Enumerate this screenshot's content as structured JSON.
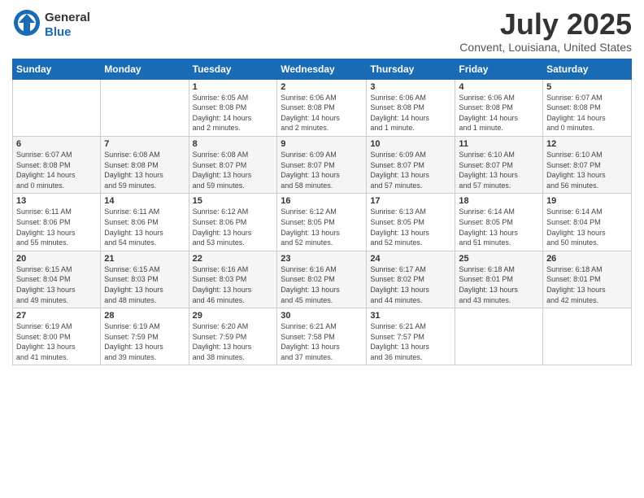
{
  "header": {
    "logo_general": "General",
    "logo_blue": "Blue",
    "title": "July 2025",
    "location": "Convent, Louisiana, United States"
  },
  "days_of_week": [
    "Sunday",
    "Monday",
    "Tuesday",
    "Wednesday",
    "Thursday",
    "Friday",
    "Saturday"
  ],
  "weeks": [
    [
      {
        "num": "",
        "info": ""
      },
      {
        "num": "",
        "info": ""
      },
      {
        "num": "1",
        "info": "Sunrise: 6:05 AM\nSunset: 8:08 PM\nDaylight: 14 hours\nand 2 minutes."
      },
      {
        "num": "2",
        "info": "Sunrise: 6:06 AM\nSunset: 8:08 PM\nDaylight: 14 hours\nand 2 minutes."
      },
      {
        "num": "3",
        "info": "Sunrise: 6:06 AM\nSunset: 8:08 PM\nDaylight: 14 hours\nand 1 minute."
      },
      {
        "num": "4",
        "info": "Sunrise: 6:06 AM\nSunset: 8:08 PM\nDaylight: 14 hours\nand 1 minute."
      },
      {
        "num": "5",
        "info": "Sunrise: 6:07 AM\nSunset: 8:08 PM\nDaylight: 14 hours\nand 0 minutes."
      }
    ],
    [
      {
        "num": "6",
        "info": "Sunrise: 6:07 AM\nSunset: 8:08 PM\nDaylight: 14 hours\nand 0 minutes."
      },
      {
        "num": "7",
        "info": "Sunrise: 6:08 AM\nSunset: 8:08 PM\nDaylight: 13 hours\nand 59 minutes."
      },
      {
        "num": "8",
        "info": "Sunrise: 6:08 AM\nSunset: 8:07 PM\nDaylight: 13 hours\nand 59 minutes."
      },
      {
        "num": "9",
        "info": "Sunrise: 6:09 AM\nSunset: 8:07 PM\nDaylight: 13 hours\nand 58 minutes."
      },
      {
        "num": "10",
        "info": "Sunrise: 6:09 AM\nSunset: 8:07 PM\nDaylight: 13 hours\nand 57 minutes."
      },
      {
        "num": "11",
        "info": "Sunrise: 6:10 AM\nSunset: 8:07 PM\nDaylight: 13 hours\nand 57 minutes."
      },
      {
        "num": "12",
        "info": "Sunrise: 6:10 AM\nSunset: 8:07 PM\nDaylight: 13 hours\nand 56 minutes."
      }
    ],
    [
      {
        "num": "13",
        "info": "Sunrise: 6:11 AM\nSunset: 8:06 PM\nDaylight: 13 hours\nand 55 minutes."
      },
      {
        "num": "14",
        "info": "Sunrise: 6:11 AM\nSunset: 8:06 PM\nDaylight: 13 hours\nand 54 minutes."
      },
      {
        "num": "15",
        "info": "Sunrise: 6:12 AM\nSunset: 8:06 PM\nDaylight: 13 hours\nand 53 minutes."
      },
      {
        "num": "16",
        "info": "Sunrise: 6:12 AM\nSunset: 8:05 PM\nDaylight: 13 hours\nand 52 minutes."
      },
      {
        "num": "17",
        "info": "Sunrise: 6:13 AM\nSunset: 8:05 PM\nDaylight: 13 hours\nand 52 minutes."
      },
      {
        "num": "18",
        "info": "Sunrise: 6:14 AM\nSunset: 8:05 PM\nDaylight: 13 hours\nand 51 minutes."
      },
      {
        "num": "19",
        "info": "Sunrise: 6:14 AM\nSunset: 8:04 PM\nDaylight: 13 hours\nand 50 minutes."
      }
    ],
    [
      {
        "num": "20",
        "info": "Sunrise: 6:15 AM\nSunset: 8:04 PM\nDaylight: 13 hours\nand 49 minutes."
      },
      {
        "num": "21",
        "info": "Sunrise: 6:15 AM\nSunset: 8:03 PM\nDaylight: 13 hours\nand 48 minutes."
      },
      {
        "num": "22",
        "info": "Sunrise: 6:16 AM\nSunset: 8:03 PM\nDaylight: 13 hours\nand 46 minutes."
      },
      {
        "num": "23",
        "info": "Sunrise: 6:16 AM\nSunset: 8:02 PM\nDaylight: 13 hours\nand 45 minutes."
      },
      {
        "num": "24",
        "info": "Sunrise: 6:17 AM\nSunset: 8:02 PM\nDaylight: 13 hours\nand 44 minutes."
      },
      {
        "num": "25",
        "info": "Sunrise: 6:18 AM\nSunset: 8:01 PM\nDaylight: 13 hours\nand 43 minutes."
      },
      {
        "num": "26",
        "info": "Sunrise: 6:18 AM\nSunset: 8:01 PM\nDaylight: 13 hours\nand 42 minutes."
      }
    ],
    [
      {
        "num": "27",
        "info": "Sunrise: 6:19 AM\nSunset: 8:00 PM\nDaylight: 13 hours\nand 41 minutes."
      },
      {
        "num": "28",
        "info": "Sunrise: 6:19 AM\nSunset: 7:59 PM\nDaylight: 13 hours\nand 39 minutes."
      },
      {
        "num": "29",
        "info": "Sunrise: 6:20 AM\nSunset: 7:59 PM\nDaylight: 13 hours\nand 38 minutes."
      },
      {
        "num": "30",
        "info": "Sunrise: 6:21 AM\nSunset: 7:58 PM\nDaylight: 13 hours\nand 37 minutes."
      },
      {
        "num": "31",
        "info": "Sunrise: 6:21 AM\nSunset: 7:57 PM\nDaylight: 13 hours\nand 36 minutes."
      },
      {
        "num": "",
        "info": ""
      },
      {
        "num": "",
        "info": ""
      }
    ]
  ]
}
